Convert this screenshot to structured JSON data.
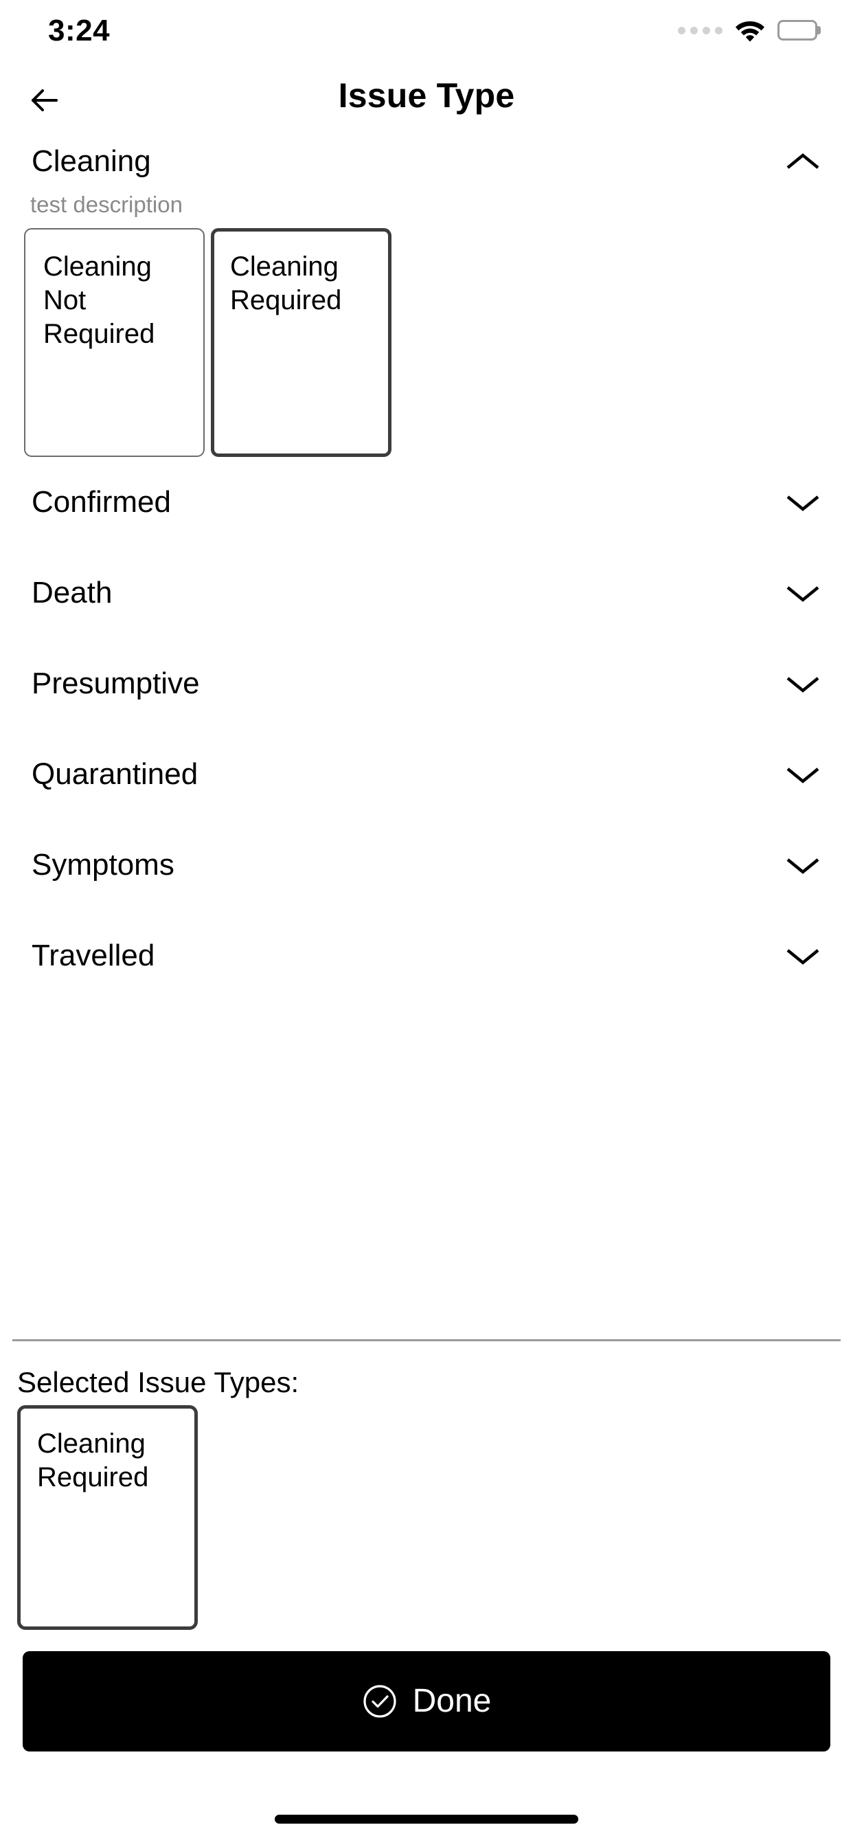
{
  "status_bar": {
    "time": "3:24",
    "dots_icon": "signal-dots-icon",
    "wifi_icon": "wifi-icon",
    "battery_icon": "battery-full-icon"
  },
  "app_bar": {
    "back_icon": "arrow-left-icon",
    "title": "Issue Type"
  },
  "groups": [
    {
      "label": "Cleaning",
      "description": "test description",
      "expanded": true,
      "chevron_icon": "chevron-up-icon",
      "options": [
        {
          "label": "Cleaning Not Required",
          "selected": false
        },
        {
          "label": "Cleaning Required",
          "selected": true
        }
      ]
    },
    {
      "label": "Confirmed",
      "expanded": false,
      "chevron_icon": "chevron-down-icon"
    },
    {
      "label": "Death",
      "expanded": false,
      "chevron_icon": "chevron-down-icon"
    },
    {
      "label": "Presumptive",
      "expanded": false,
      "chevron_icon": "chevron-down-icon"
    },
    {
      "label": "Quarantined",
      "expanded": false,
      "chevron_icon": "chevron-down-icon"
    },
    {
      "label": "Symptoms",
      "expanded": false,
      "chevron_icon": "chevron-down-icon"
    },
    {
      "label": "Travelled",
      "expanded": false,
      "chevron_icon": "chevron-down-icon"
    }
  ],
  "bottom_panel": {
    "selected_label": "Selected Issue Types:",
    "selected_items": [
      {
        "label": "Cleaning Required"
      }
    ],
    "done_button": {
      "label": "Done",
      "icon": "check-circle-icon",
      "background": "#000000",
      "text_color": "#ffffff"
    }
  },
  "colors": {
    "background": "#ffffff",
    "text": "#000000",
    "muted_text": "#8a8a8a",
    "chip_border": "#6b6b6b",
    "chip_border_selected": "#3c3c3c",
    "divider": "#9a9a9a"
  }
}
